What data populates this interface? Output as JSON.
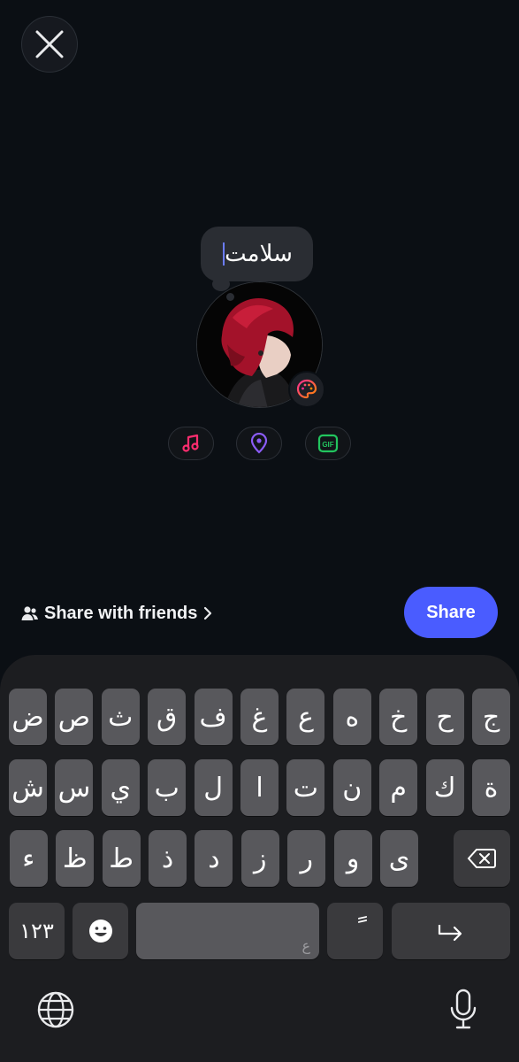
{
  "note": {
    "text": "سلامت"
  },
  "share_row": {
    "audience_label": "Share with friends",
    "share_button": "Share"
  },
  "attachments": [
    {
      "name": "music",
      "icon": "music-note-icon",
      "color": "#ff2d6f"
    },
    {
      "name": "location",
      "icon": "location-pin-icon",
      "color": "#8b5cf6"
    },
    {
      "name": "gif",
      "icon": "gif-icon",
      "label": "GIF",
      "color": "#22c55e"
    }
  ],
  "keyboard": {
    "row1": [
      "ج",
      "ح",
      "خ",
      "ه",
      "ع",
      "غ",
      "ف",
      "ق",
      "ث",
      "ص",
      "ض"
    ],
    "row2": [
      "ة",
      "ك",
      "م",
      "ن",
      "ت",
      "ا",
      "ل",
      "ب",
      "ي",
      "س",
      "ش"
    ],
    "row3": [
      "ى",
      "و",
      "ر",
      "ز",
      "د",
      "ذ",
      "ط",
      "ظ",
      "ء"
    ],
    "numbers_key": "١٢٣",
    "space_hint": "ع",
    "diacritic_key": "ً"
  },
  "colors": {
    "background": "#0b0f14",
    "accent": "#4a5cff",
    "keyboard": "#1c1d20",
    "key": "#58585c"
  }
}
